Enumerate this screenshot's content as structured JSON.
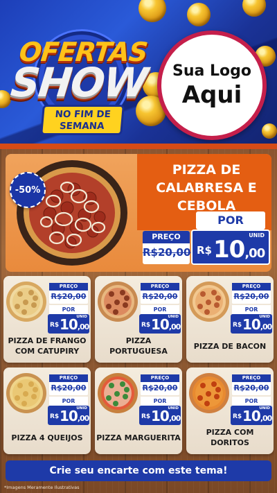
{
  "header": {
    "badge_line1": "OFERTAS",
    "badge_line2": "SHOW",
    "badge_line3": "NO FIM DE",
    "badge_line4": "SEMANA",
    "logo_line1": "Sua Logo",
    "logo_line2": "Aqui"
  },
  "featured": {
    "discount": "-50%",
    "title": "PIZZA DE CALABRESA E CEBOLA",
    "preco_label": "PREÇO",
    "old_price": "R$20,00",
    "por_label": "POR",
    "unid_label": "UNID",
    "currency": "R$",
    "price_int": "10",
    "price_cents": ",00"
  },
  "cards": [
    {
      "name": "PIZZA DE FRANGO COM CATUPIRY",
      "preco_label": "PREÇO",
      "old_price": "R$20,00",
      "por_label": "POR",
      "unid_label": "UNID",
      "currency": "R$",
      "price_int": "10",
      "price_cents": ",00"
    },
    {
      "name": "PIZZA PORTUGUESA",
      "preco_label": "PREÇO",
      "old_price": "R$20,00",
      "por_label": "POR",
      "unid_label": "UNID",
      "currency": "R$",
      "price_int": "10",
      "price_cents": ",00"
    },
    {
      "name": "PIZZA DE BACON",
      "preco_label": "PREÇO",
      "old_price": "R$20,00",
      "por_label": "POR",
      "unid_label": "UNID",
      "currency": "R$",
      "price_int": "10",
      "price_cents": ",00"
    },
    {
      "name": "PIZZA 4 QUEIJOS",
      "preco_label": "PREÇO",
      "old_price": "R$20,00",
      "por_label": "POR",
      "unid_label": "UNID",
      "currency": "R$",
      "price_int": "10",
      "price_cents": ",00"
    },
    {
      "name": "PIZZA MARGUERITA",
      "preco_label": "PREÇO",
      "old_price": "R$20,00",
      "por_label": "POR",
      "unid_label": "UNID",
      "currency": "R$",
      "price_int": "10",
      "price_cents": ",00"
    },
    {
      "name": "PIZZA COM DORITOS",
      "preco_label": "PREÇO",
      "old_price": "R$20,00",
      "por_label": "POR",
      "unid_label": "UNID",
      "currency": "R$",
      "price_int": "10",
      "price_cents": ",00"
    }
  ],
  "footer": {
    "cta": "Crie seu encarte com este tema!",
    "disclaimer": "*Imagens Meramente Ilustrativas"
  },
  "colors": {
    "brand_blue": "#1e3aa8",
    "accent_orange": "#e45e12",
    "logo_ring": "#c51f4b",
    "gold": "#ffc21a"
  }
}
